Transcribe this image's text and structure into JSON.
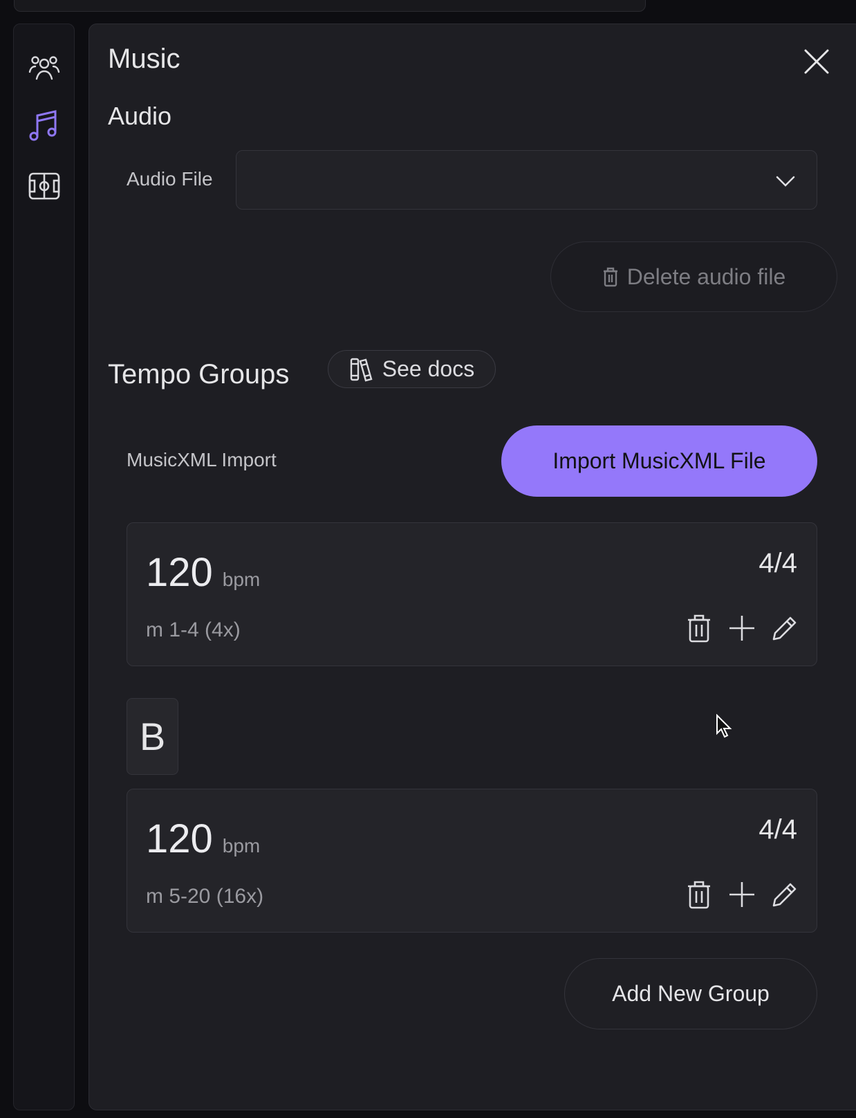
{
  "panel": {
    "title": "Music",
    "close_icon": "close-icon"
  },
  "sidebar": {
    "items": [
      {
        "icon": "users-icon",
        "active": false
      },
      {
        "icon": "music-note-icon",
        "active": true
      },
      {
        "icon": "field-icon",
        "active": false
      }
    ]
  },
  "audio": {
    "heading": "Audio",
    "file_label": "Audio File",
    "file_value": "",
    "delete_label": "Delete audio file"
  },
  "tempo": {
    "heading": "Tempo Groups",
    "docs_label": "See docs",
    "import_label": "MusicXML Import",
    "import_button": "Import MusicXML File",
    "groups": [
      {
        "bpm": "120",
        "unit": "bpm",
        "time_signature": "4/4",
        "range": "m 1-4 (4x)"
      },
      {
        "name": "B",
        "bpm": "120",
        "unit": "bpm",
        "time_signature": "4/4",
        "range": "m 5-20 (16x)"
      }
    ],
    "add_group": "Add New Group"
  },
  "colors": {
    "accent": "#9478fa",
    "panel": "#1e1e23",
    "background": "#0d0d11"
  }
}
